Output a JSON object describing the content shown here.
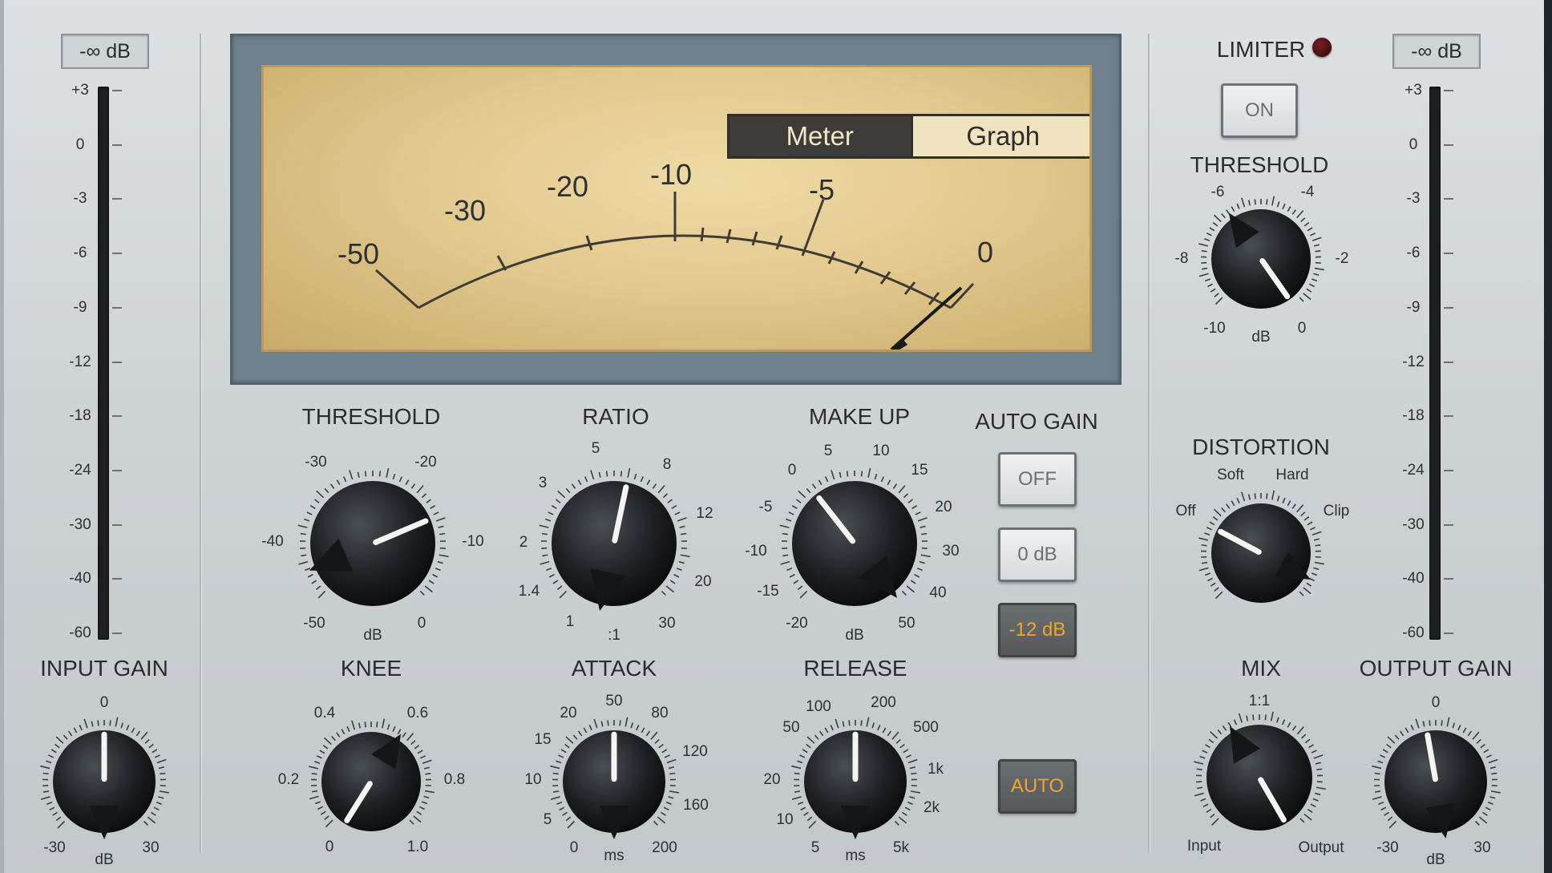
{
  "input": {
    "readout": "-∞ dB",
    "scale": [
      "+3",
      "0",
      "-3",
      "-6",
      "-9",
      "-12",
      "-18",
      "-24",
      "-30",
      "-40",
      "-60"
    ],
    "gain_label": "INPUT GAIN",
    "gain_min": "-30",
    "gain_mid": "0",
    "gain_max": "30",
    "gain_unit": "dB",
    "gain_value": 0
  },
  "output": {
    "readout": "-∞ dB",
    "scale": [
      "+3",
      "0",
      "-3",
      "-6",
      "-9",
      "-12",
      "-18",
      "-24",
      "-30",
      "-40",
      "-60"
    ],
    "gain_label": "OUTPUT GAIN",
    "gain_min": "-30",
    "gain_mid": "0",
    "gain_max": "30",
    "gain_unit": "dB",
    "gain_value": 0
  },
  "meter": {
    "tabs": [
      "Meter",
      "Graph"
    ],
    "selected_tab": "Meter",
    "scale_labels": [
      "-50",
      "-30",
      "-20",
      "-10",
      "-5",
      "0"
    ],
    "needle_value": "0"
  },
  "threshold": {
    "label": "THRESHOLD",
    "marks": [
      "-30",
      "-20",
      "-40",
      "-10",
      "-50",
      "0"
    ],
    "unit": "dB",
    "value": -13
  },
  "ratio": {
    "label": "RATIO",
    "marks": [
      "5",
      "8",
      "3",
      "12",
      "2",
      "20",
      "1.4",
      "30",
      "1"
    ],
    "unit": ":1",
    "value": 6
  },
  "makeup": {
    "label": "MAKE UP",
    "marks": [
      "0",
      "5",
      "10",
      "15",
      "-5",
      "20",
      "-10",
      "30",
      "-15",
      "40",
      "-20",
      "50"
    ],
    "unit": "dB",
    "value": -3
  },
  "autogain": {
    "label": "AUTO GAIN",
    "off": "OFF",
    "zero": "0 dB",
    "minus12": "-12 dB",
    "selected": "-12 dB"
  },
  "knee": {
    "label": "KNEE",
    "marks": [
      "0.4",
      "0.6",
      "0.2",
      "0.8",
      "0",
      "1.0"
    ],
    "value": 0
  },
  "attack": {
    "label": "ATTACK",
    "marks": [
      "50",
      "20",
      "80",
      "15",
      "120",
      "10",
      "160",
      "5",
      "0",
      "200"
    ],
    "unit": "ms",
    "value": 50
  },
  "release": {
    "label": "RELEASE",
    "marks": [
      "100",
      "200",
      "50",
      "500",
      "1k",
      "20",
      "2k",
      "10",
      "5",
      "5k"
    ],
    "unit": "ms",
    "value": 200
  },
  "auto_button": "AUTO",
  "limiter": {
    "label": "LIMITER",
    "on_button": "ON",
    "threshold_label": "THRESHOLD",
    "marks": [
      "-6",
      "-4",
      "-8",
      "-2",
      "-10",
      "0"
    ],
    "unit": "dB",
    "value": 0
  },
  "distortion": {
    "label": "DISTORTION",
    "marks": [
      "Soft",
      "Hard",
      "Off",
      "Clip"
    ],
    "value": "Off"
  },
  "mix": {
    "label": "MIX",
    "top": "1:1",
    "left": "Input",
    "right": "Output",
    "value": "Output"
  },
  "colors": {
    "accent_orange": "#f0a628",
    "meter_face": "#e6cd92",
    "led_off": "#5a1214",
    "panel": "#cdd2d5"
  }
}
